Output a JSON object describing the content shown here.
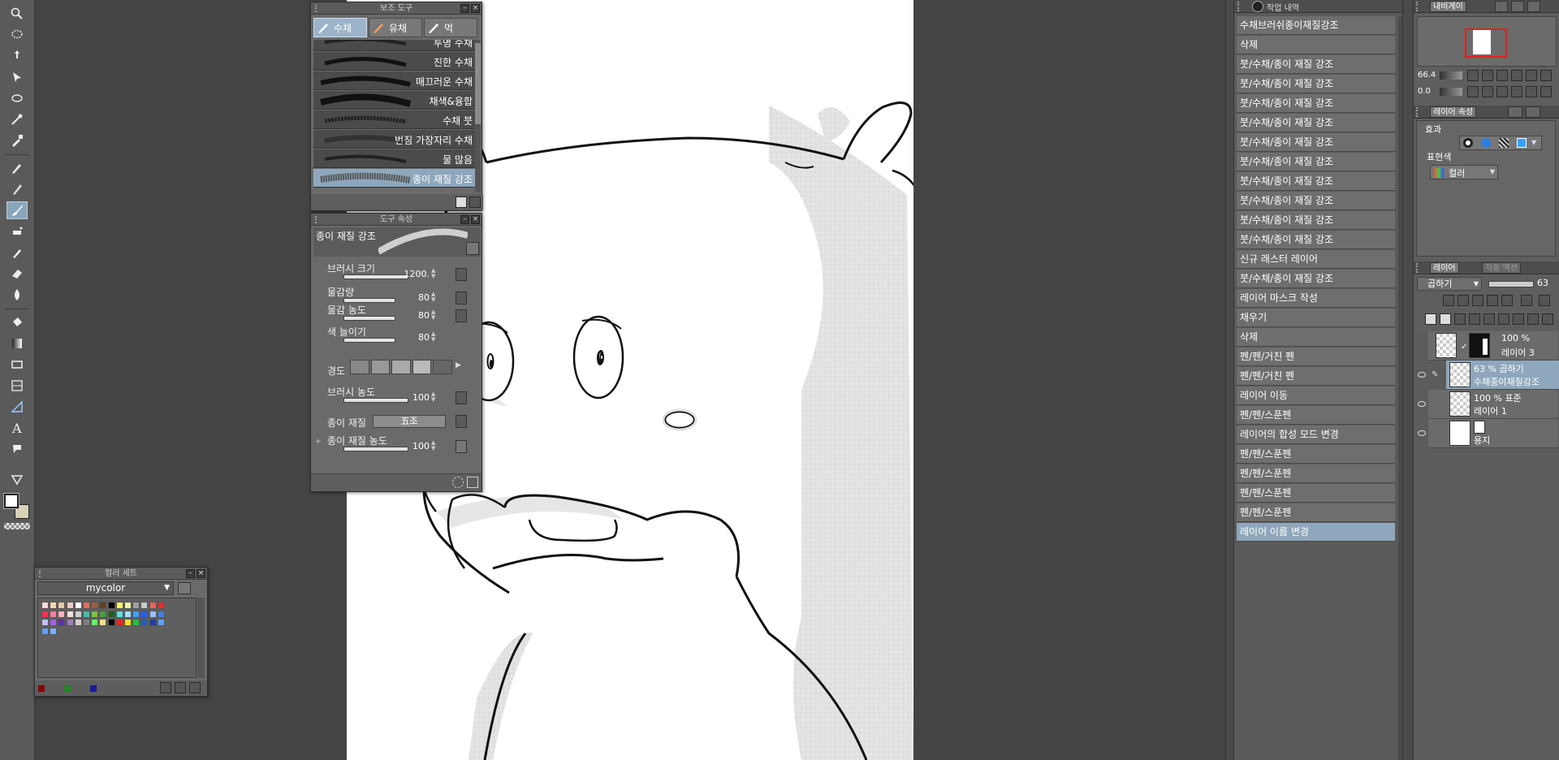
{
  "sub_tool": {
    "title": "보조 도구",
    "tabs": [
      {
        "label": "수채",
        "active": true
      },
      {
        "label": "유채",
        "active": false
      },
      {
        "label": "먹",
        "active": false
      }
    ],
    "brushes": [
      {
        "name": "투명 수채",
        "selected": false
      },
      {
        "name": "진한 수채",
        "selected": false
      },
      {
        "name": "매끄러운 수채",
        "selected": false
      },
      {
        "name": "채색&융합",
        "selected": false
      },
      {
        "name": "수채 붓",
        "selected": false
      },
      {
        "name": "번짐 가장자리 수채",
        "selected": false
      },
      {
        "name": "물 많음",
        "selected": false
      },
      {
        "name": "종이 재질 강조",
        "selected": true
      }
    ]
  },
  "tool_property": {
    "title": "도구 속성",
    "current_tool": "종이 재질 강조",
    "brush_size_label": "브러시 크기",
    "brush_size_value": "1200.",
    "paint_amount_label": "물감량",
    "paint_amount_value": "80",
    "paint_density_label": "물감 농도",
    "paint_density_value": "80",
    "color_stretch_label": "색 늘이기",
    "color_stretch_value": "80",
    "hardness_label": "경도",
    "brush_density_label": "브러시 농도",
    "brush_density_value": "100",
    "paper_texture_label": "종이 재질",
    "paper_texture_value": "五조",
    "paper_texture_density_label": "종이 재질 농도",
    "paper_texture_density_value": "100"
  },
  "color_set": {
    "title": "컬러 세트",
    "set_name": "mycolor",
    "swatch_rows": [
      [
        "#ffd6d6",
        "#f2d6b3",
        "#e8c9a8",
        "#f0c8c8",
        "#ffffff",
        "#e07060",
        "#9a6040",
        "#604020",
        "#000000",
        "#fff060",
        "#f0f0a0",
        "#a0a0a0",
        "#c8c8c8",
        "#f06060",
        "#e03030"
      ],
      [
        "#ff3050",
        "#ff80a0",
        "#ffb0c0",
        "#f0e0e0",
        "#d0d0d0",
        "#40c0a0",
        "#80c040",
        "#40a040",
        "#206020",
        "#60e0e0",
        "#a0e0ff",
        "#40a0ff",
        "#2060ff",
        "#a0c0ff",
        "#4080e0"
      ],
      [
        "#c0c0ff",
        "#a060e0",
        "#6030a0",
        "#a080c0",
        "#d0d0d0",
        "#808080",
        "#60ff60",
        "#ffe080",
        "#000000",
        "#ff2020",
        "#ffe020",
        "#20c040",
        "#2060c0",
        "#2040a0",
        "#60a0ff"
      ],
      [
        "#60a0ff",
        "#80b0ff"
      ]
    ],
    "bottom_colors": [
      "#8b0000",
      "#1e8a1e",
      "#1a1a9a"
    ]
  },
  "history": {
    "title": "작업 내역",
    "items": [
      {
        "label": "수채브러쉬종이재질강조",
        "selected": false
      },
      {
        "label": "삭제",
        "selected": false
      },
      {
        "label": "붓/수채/종이 재질 강조",
        "selected": false
      },
      {
        "label": "붓/수채/종이 재질 강조",
        "selected": false
      },
      {
        "label": "붓/수채/종이 재질 강조",
        "selected": false
      },
      {
        "label": "붓/수채/종이 재질 강조",
        "selected": false
      },
      {
        "label": "붓/수채/종이 재질 강조",
        "selected": false
      },
      {
        "label": "붓/수채/종이 재질 강조",
        "selected": false
      },
      {
        "label": "붓/수채/종이 재질 강조",
        "selected": false
      },
      {
        "label": "붓/수채/종이 재질 강조",
        "selected": false
      },
      {
        "label": "붓/수채/종이 재질 강조",
        "selected": false
      },
      {
        "label": "붓/수채/종이 재질 강조",
        "selected": false
      },
      {
        "label": "신규 래스터 레이어",
        "selected": false
      },
      {
        "label": "붓/수채/종이 재질 강조",
        "selected": false
      },
      {
        "label": "레이어 마스크 작성",
        "selected": false
      },
      {
        "label": "채우기",
        "selected": false
      },
      {
        "label": "삭제",
        "selected": false
      },
      {
        "label": "펜/펜/거친 펜",
        "selected": false
      },
      {
        "label": "펜/펜/거친 펜",
        "selected": false
      },
      {
        "label": "레이어 이동",
        "selected": false
      },
      {
        "label": "펜/펜/스푼펜",
        "selected": false
      },
      {
        "label": "레이어의 합성 모드 변경",
        "selected": false
      },
      {
        "label": "펜/펜/스푼펜",
        "selected": false
      },
      {
        "label": "펜/펜/스푼펜",
        "selected": false
      },
      {
        "label": "펜/펜/스푼펜",
        "selected": false
      },
      {
        "label": "펜/펜/스푼펜",
        "selected": false
      },
      {
        "label": "레이어 이름 변경",
        "selected": true
      }
    ]
  },
  "navigator": {
    "tab_label": "내비게이",
    "zoom_value": "66.4",
    "rotate_value": "0.0"
  },
  "layer_property": {
    "tab_label": "레이어 속성",
    "effect_label": "효과",
    "expression_color_label": "표현색",
    "expression_color_value": "컬러"
  },
  "layers": {
    "tab_label": "레이어",
    "tab2_label": "자동 액션",
    "blend_mode": "곱하기",
    "opacity": "63",
    "items": [
      {
        "opacity_mode": "100 %",
        "name": "레이어 3",
        "selected": false,
        "type": "mask"
      },
      {
        "opacity_mode": "63 %  곱하기",
        "name": "수채종이재질강조",
        "selected": true,
        "type": "raster"
      },
      {
        "opacity_mode": "100 %  표준",
        "name": "레이어 1",
        "selected": false,
        "type": "raster"
      },
      {
        "opacity_mode": "",
        "name": "용지",
        "selected": false,
        "type": "paper"
      }
    ]
  },
  "colors": {
    "main_color": "#ffffff",
    "sub_color": "#d7d2b8",
    "accent": "#8ea7bc"
  }
}
